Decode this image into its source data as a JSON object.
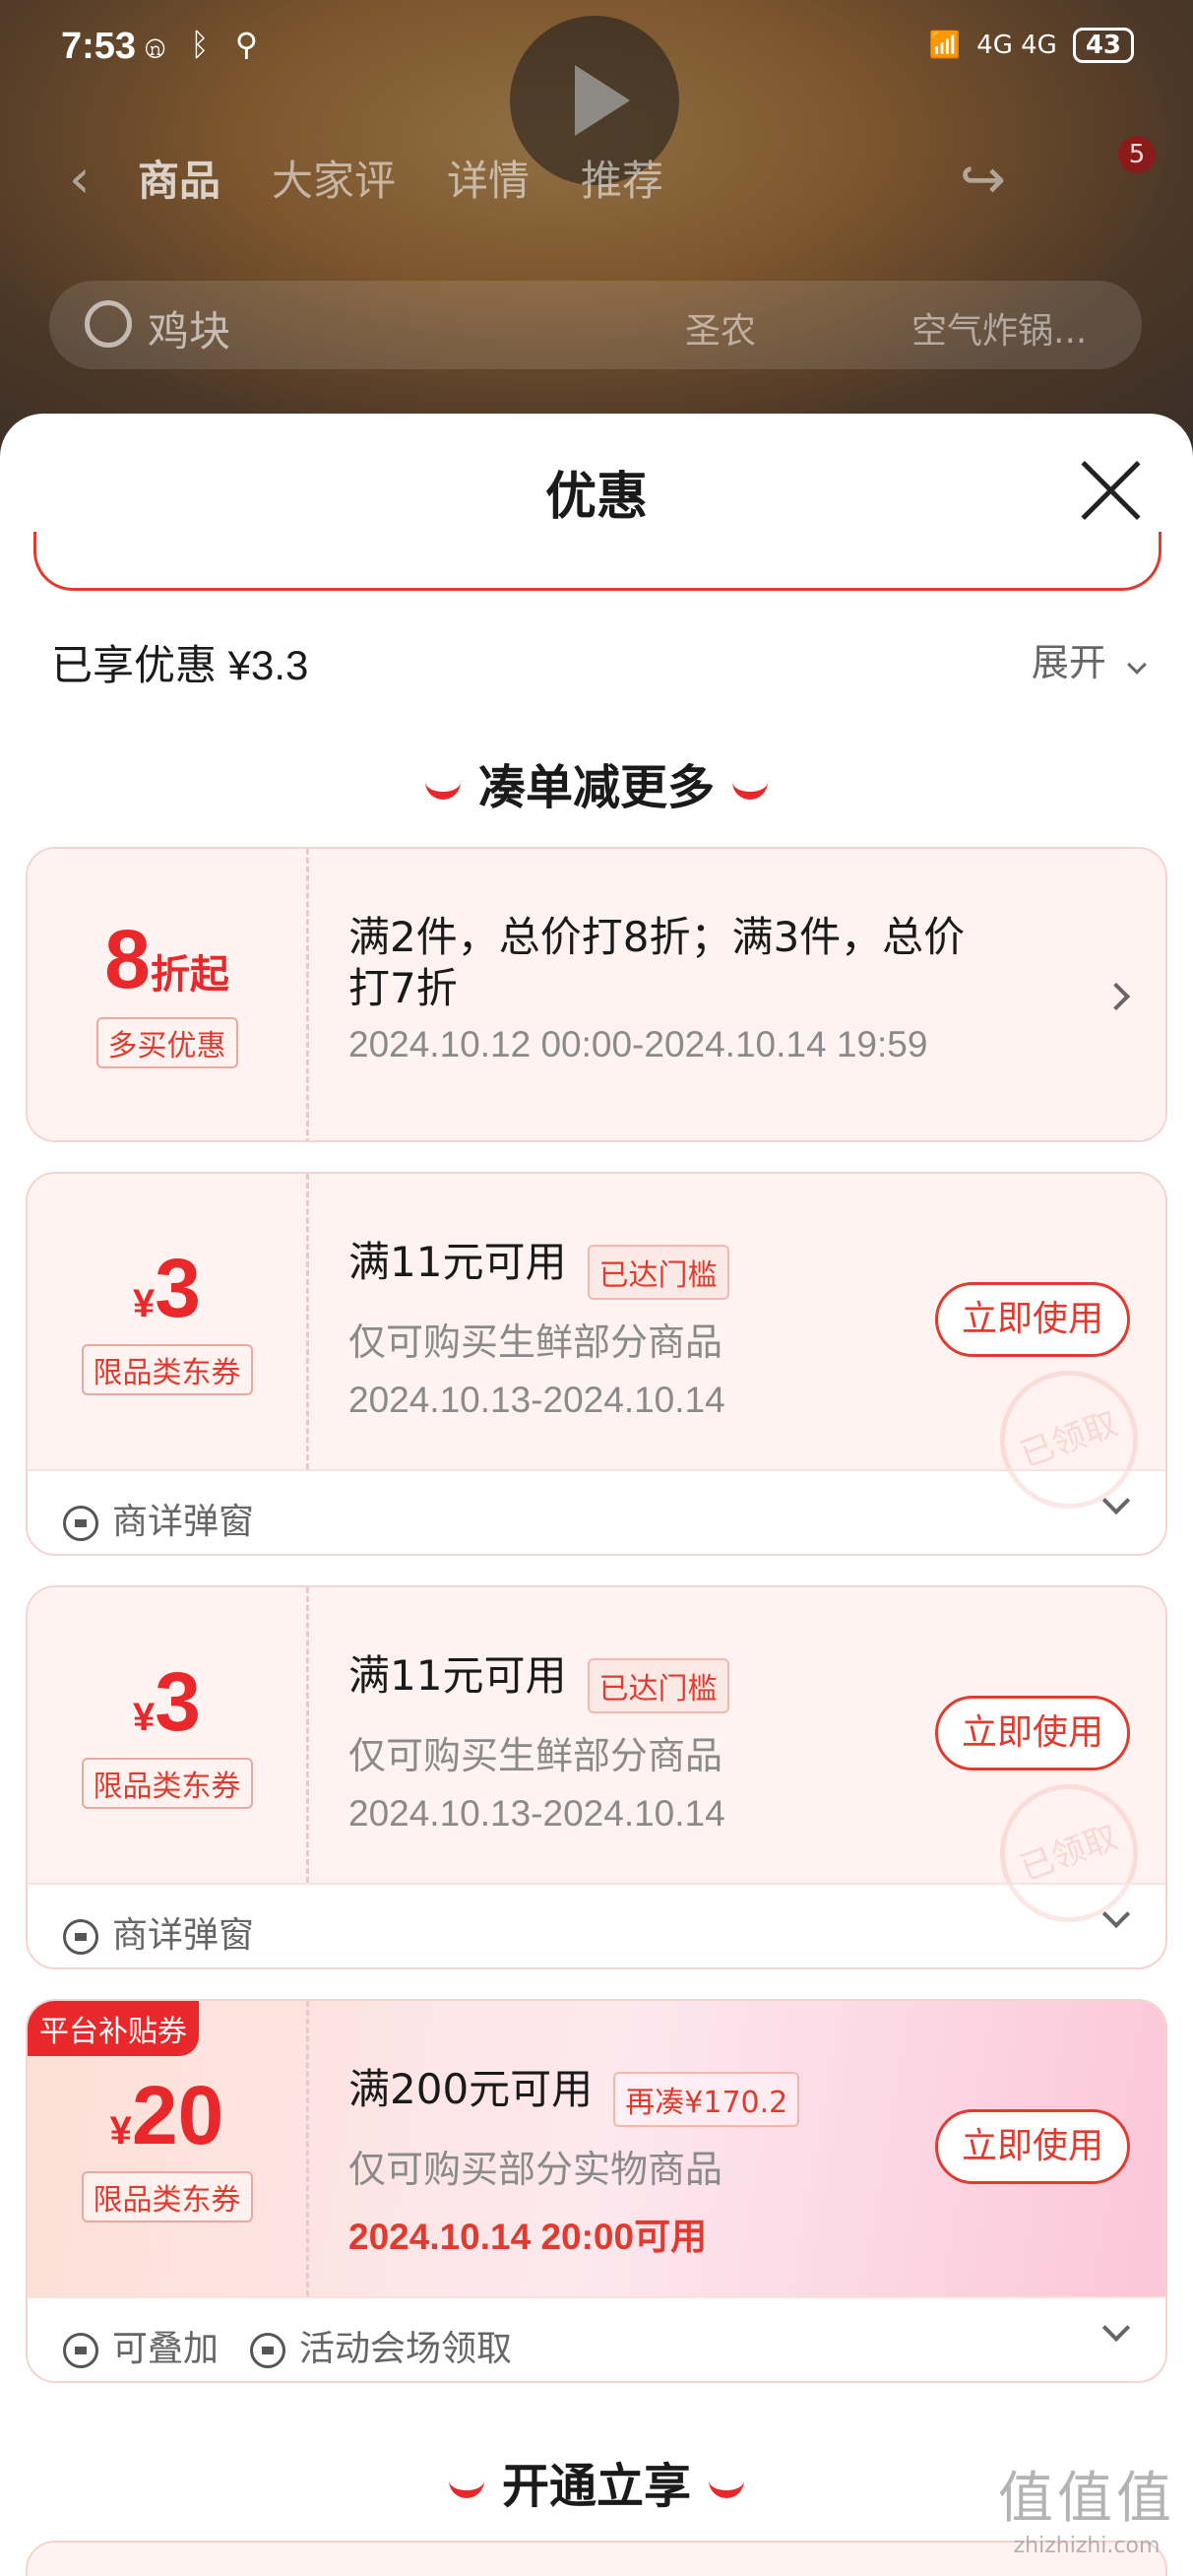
{
  "status_bar": {
    "time": "7:53",
    "battery": "43",
    "left_icons": "ⓝ ᛒ ⚲",
    "right_icons": "4G 4G"
  },
  "background": {
    "nav_tabs": [
      "商品",
      "大家评",
      "详情",
      "推荐"
    ],
    "cart_badge": "5",
    "search_text": "鸡块",
    "search_tags": [
      "圣农",
      "空气炸锅..."
    ]
  },
  "sheet": {
    "title": "优惠",
    "enjoyed": "已享优惠 ¥3.3",
    "expand_label": "展开",
    "section1_title": "凑单减更多",
    "section2_title": "开通立享"
  },
  "cards": [
    {
      "amount_big": "8",
      "amount_small": "折起",
      "tag": "多买优惠",
      "condition": "满2件，总价打8折；满3件，总价打7折",
      "date": "2024.10.12 00:00-2024.10.14 19:59"
    },
    {
      "currency": "¥",
      "amount_big": "3",
      "tag": "限品类东券",
      "condition": "满11元可用",
      "reach_tag": "已达门槛",
      "sub": "仅可购买生鲜部分商品",
      "date": "2024.10.13-2024.10.14",
      "button": "立即使用",
      "stamp": "已领取",
      "foot": "商详弹窗"
    },
    {
      "currency": "¥",
      "amount_big": "3",
      "tag": "限品类东券",
      "condition": "满11元可用",
      "reach_tag": "已达门槛",
      "sub": "仅可购买生鲜部分商品",
      "date": "2024.10.13-2024.10.14",
      "button": "立即使用",
      "stamp": "已领取",
      "foot": "商详弹窗"
    },
    {
      "platform_tag": "平台补贴券",
      "currency": "¥",
      "amount_big": "20",
      "tag": "限品类东券",
      "condition": "满200元可用",
      "reach_tag": "再凑¥170.2",
      "sub": "仅可购买部分实物商品",
      "date": "2024.10.14 20:00可用",
      "button": "立即使用",
      "foot1": "可叠加",
      "foot2": "活动会场领取"
    }
  ],
  "watermark": {
    "big": "值值值",
    "small": "zhizhizhi.com"
  }
}
